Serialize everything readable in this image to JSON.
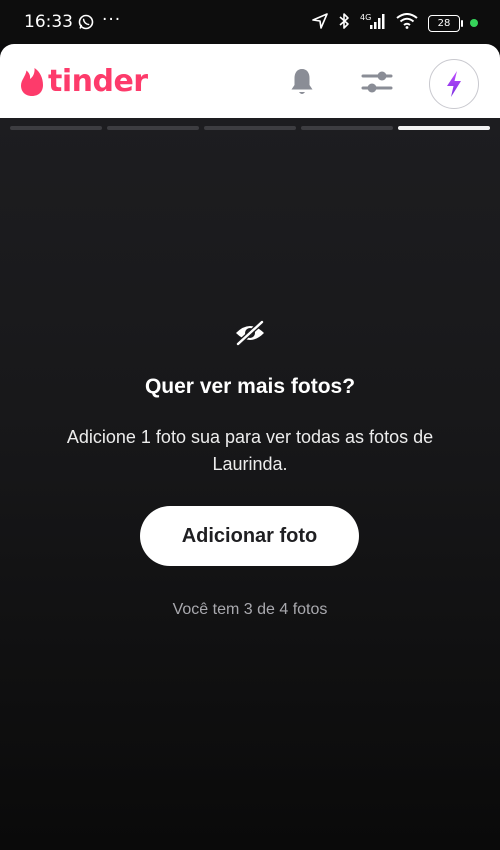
{
  "status_bar": {
    "time": "16:33",
    "dots": "···",
    "network": "4G",
    "battery": "28"
  },
  "header": {
    "logo_text": "tinder",
    "brand_color": "#fd3b6b",
    "icons": [
      "bell-icon",
      "filters-icon",
      "boost-icon"
    ]
  },
  "profile_card": {
    "photo_indicator": {
      "total": 5,
      "active_index": 4
    },
    "title": "Quer ver mais fotos?",
    "description": "Adicione 1 foto sua para ver todas as fotos de Laurinda.",
    "add_button_label": "Adicionar foto",
    "photo_count": "Você tem 3 de 4 fotos"
  }
}
